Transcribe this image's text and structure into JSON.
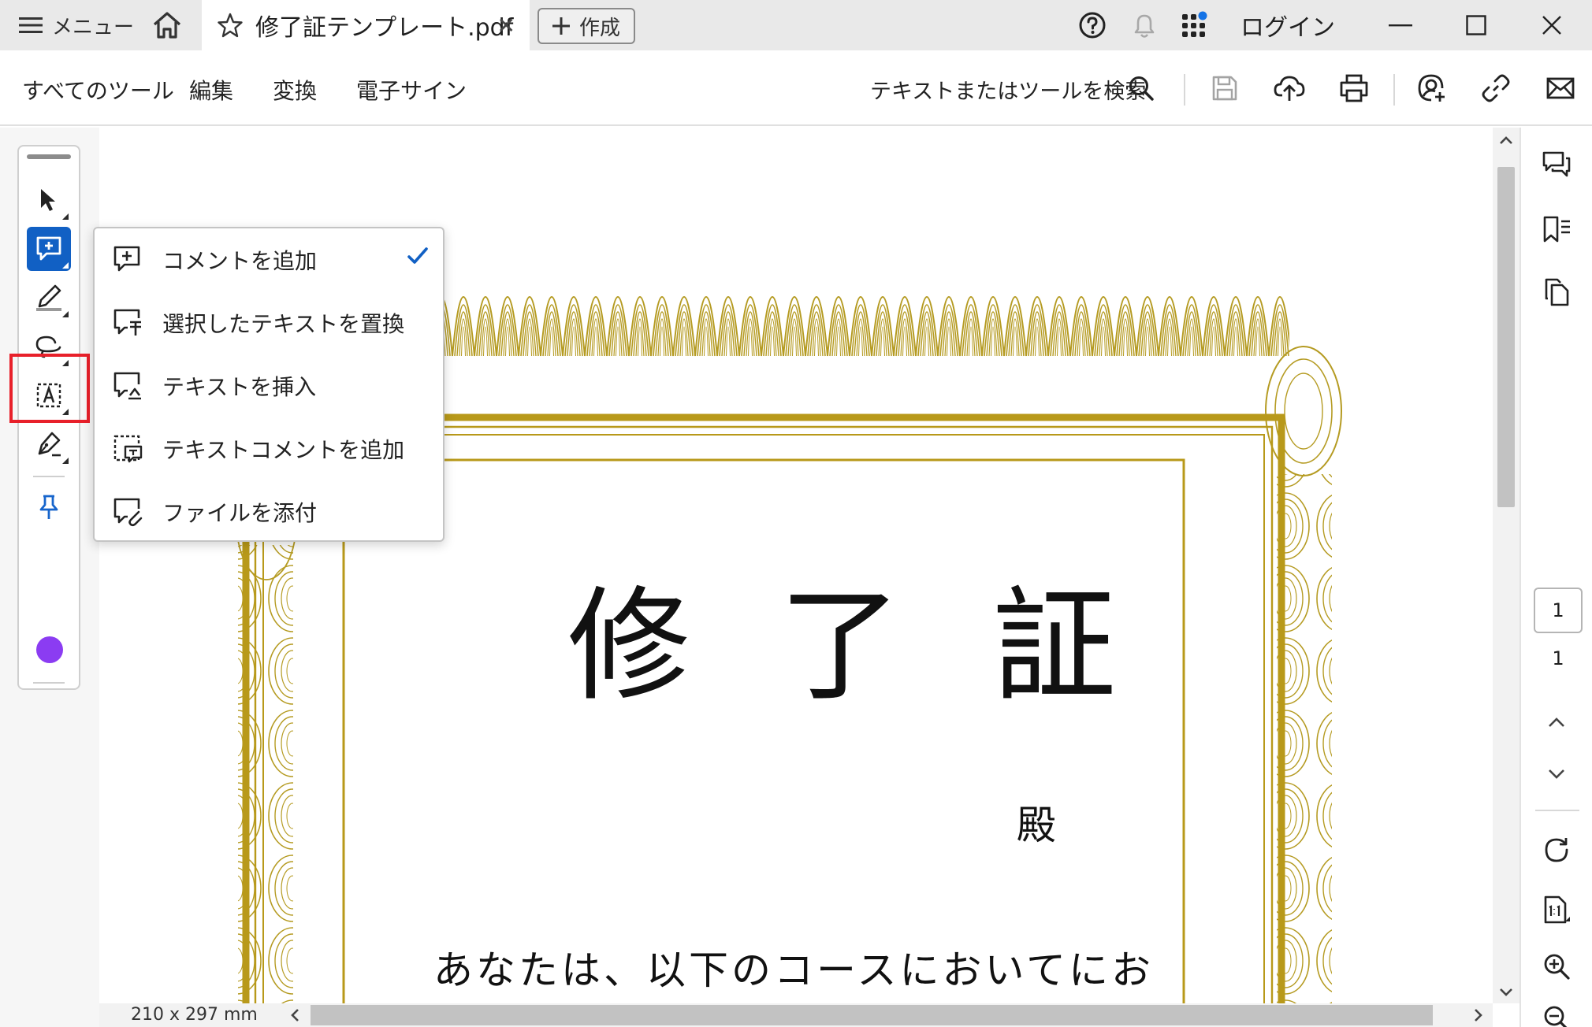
{
  "titlebar": {
    "menu_label": "メニュー",
    "doc_tab_title": "修了証テンプレート.pdf",
    "create_label": "作成",
    "login_label": "ログイン"
  },
  "toolbar": {
    "tabs": [
      "すべてのツール",
      "編集",
      "変換",
      "電子サイン"
    ],
    "search_label": "テキストまたはツールを検索"
  },
  "comment_menu": {
    "items": [
      {
        "label": "コメントを追加",
        "icon": "add-comment-icon",
        "checked": true
      },
      {
        "label": "選択したテキストを置換",
        "icon": "replace-text-icon",
        "checked": false
      },
      {
        "label": "テキストを挿入",
        "icon": "insert-text-icon",
        "checked": false
      },
      {
        "label": "テキストコメントを追加",
        "icon": "text-comment-icon",
        "checked": false
      },
      {
        "label": "ファイルを添付",
        "icon": "attach-file-icon",
        "checked": false
      }
    ]
  },
  "tools": {
    "active_color": "#8b3cf2",
    "accent": "#1160c4",
    "highlight_border": "#e8202a"
  },
  "document": {
    "title_chars": [
      "修",
      "了",
      "証"
    ],
    "dono": "殿",
    "body_line": "あなたは、以下のコースにおいてにお",
    "page_size": "210 x 297 mm",
    "border_color": "#b39a22"
  },
  "navigation": {
    "current_page": "1",
    "total_pages": "1"
  }
}
